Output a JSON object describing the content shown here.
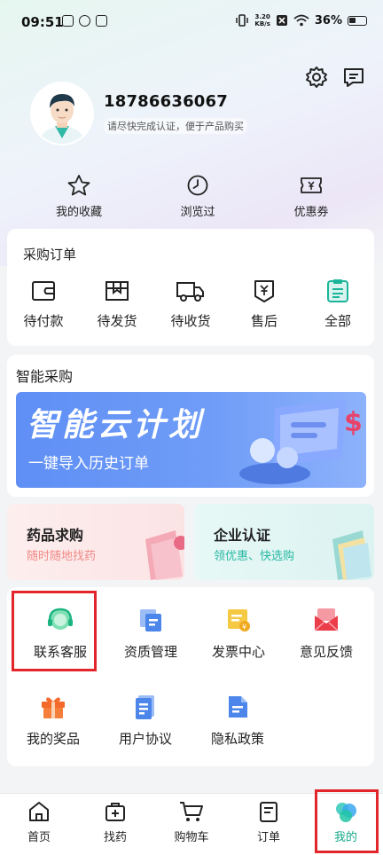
{
  "status_bar": {
    "time": "09:51",
    "net_speed_value": "3.20",
    "net_speed_unit": "KB/s",
    "battery": "36%"
  },
  "profile": {
    "phone": "18786636067",
    "hint": "请尽快完成认证，便于产品购买"
  },
  "quick_links": [
    {
      "label": "我的收藏",
      "icon": "star-icon"
    },
    {
      "label": "浏览过",
      "icon": "clock-icon"
    },
    {
      "label": "优惠券",
      "icon": "coupon-icon"
    }
  ],
  "orders": {
    "title": "采购订单",
    "items": [
      {
        "label": "待付款",
        "icon": "wallet-icon"
      },
      {
        "label": "待发货",
        "icon": "box-icon"
      },
      {
        "label": "待收货",
        "icon": "truck-icon"
      },
      {
        "label": "售后",
        "icon": "after-sale-icon"
      },
      {
        "label": "全部",
        "icon": "clipboard-icon"
      }
    ]
  },
  "smart": {
    "title": "智能采购",
    "banner_title": "智能云计划",
    "banner_sub": "一键导入历史订单"
  },
  "features": [
    {
      "title": "药品求购",
      "sub": "随时随地找药",
      "sub_color": "#f08a86"
    },
    {
      "title": "企业认证",
      "sub": "领优惠、快选购",
      "sub_color": "#28b8a3"
    }
  ],
  "services": [
    {
      "label": "联系客服",
      "icon": "customer-service-icon"
    },
    {
      "label": "资质管理",
      "icon": "qualification-icon"
    },
    {
      "label": "发票中心",
      "icon": "invoice-icon"
    },
    {
      "label": "意见反馈",
      "icon": "feedback-icon"
    },
    {
      "label": "我的奖品",
      "icon": "gift-icon"
    },
    {
      "label": "用户协议",
      "icon": "agreement-icon"
    },
    {
      "label": "隐私政策",
      "icon": "privacy-icon"
    }
  ],
  "tabs": [
    {
      "label": "首页",
      "icon": "home-icon"
    },
    {
      "label": "找药",
      "icon": "medicine-box-icon"
    },
    {
      "label": "购物车",
      "icon": "cart-icon"
    },
    {
      "label": "订单",
      "icon": "order-icon"
    },
    {
      "label": "我的",
      "icon": "me-icon",
      "active": true
    }
  ],
  "colors": {
    "accent": "#15a88a",
    "highlight": "#e3262b",
    "banner": "#5f8ff5"
  }
}
